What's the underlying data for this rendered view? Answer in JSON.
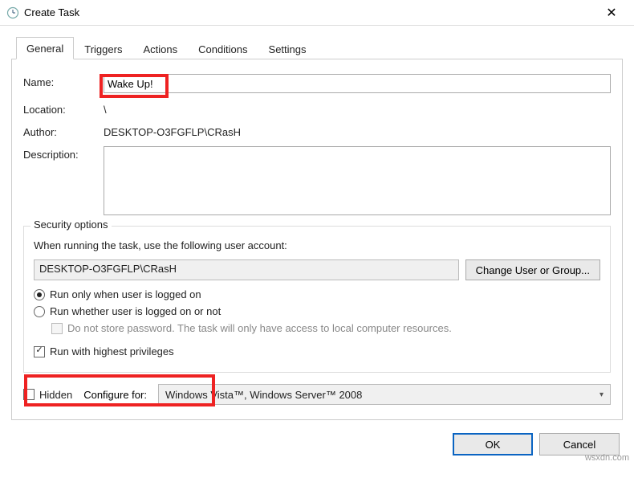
{
  "window": {
    "title": "Create Task"
  },
  "tabs": [
    "General",
    "Triggers",
    "Actions",
    "Conditions",
    "Settings"
  ],
  "form": {
    "name_label": "Name:",
    "name_value": "Wake Up!",
    "location_label": "Location:",
    "location_value": "\\",
    "author_label": "Author:",
    "author_value": "DESKTOP-O3FGFLP\\CRasH",
    "description_label": "Description:",
    "description_value": ""
  },
  "security": {
    "title": "Security options",
    "intro": "When running the task, use the following user account:",
    "user": "DESKTOP-O3FGFLP\\CRasH",
    "change_btn": "Change User or Group...",
    "radio_logged_on": "Run only when user is logged on",
    "radio_logged_off": "Run whether user is logged on or not",
    "no_store_pw": "Do not store password.  The task will only have access to local computer resources.",
    "highest_priv": "Run with highest privileges"
  },
  "bottom": {
    "hidden_label": "Hidden",
    "configure_label": "Configure for:",
    "configure_value": "Windows Vista™, Windows Server™ 2008"
  },
  "buttons": {
    "ok": "OK",
    "cancel": "Cancel"
  },
  "watermark": "wsxdn.com"
}
